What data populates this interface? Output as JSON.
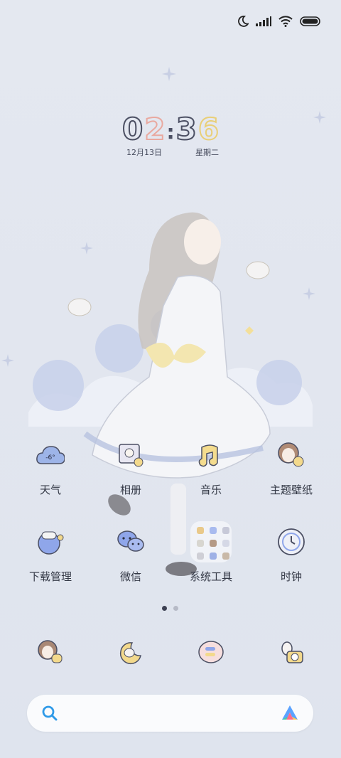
{
  "clock": {
    "d1": "0",
    "d2": "2",
    "sep": ":",
    "d3": "3",
    "d4": "6",
    "date": "12月13日",
    "weekday": "星期二"
  },
  "weather_icon_text": "-6°",
  "apps_row1": [
    {
      "label": "天气",
      "icon": "weather-icon"
    },
    {
      "label": "相册",
      "icon": "gallery-icon"
    },
    {
      "label": "音乐",
      "icon": "music-icon"
    },
    {
      "label": "主题壁纸",
      "icon": "themes-icon"
    }
  ],
  "apps_row2": [
    {
      "label": "下载管理",
      "icon": "downloads-icon"
    },
    {
      "label": "微信",
      "icon": "wechat-icon"
    },
    {
      "label": "系统工具",
      "icon": "folder-icon"
    },
    {
      "label": "时钟",
      "icon": "clock-icon"
    }
  ],
  "page_indicator": {
    "pages": 2,
    "current": 1
  },
  "dock": [
    "phone-icon",
    "contacts-icon",
    "messages-icon",
    "camera-icon"
  ],
  "colors": {
    "background": "#e2e6ef",
    "digit0": "#4b4f63",
    "digit2": "#f2b8b0",
    "digit3": "#4b4f63",
    "digit6": "#f4dc8e",
    "search_blue": "#2f9ae8"
  }
}
